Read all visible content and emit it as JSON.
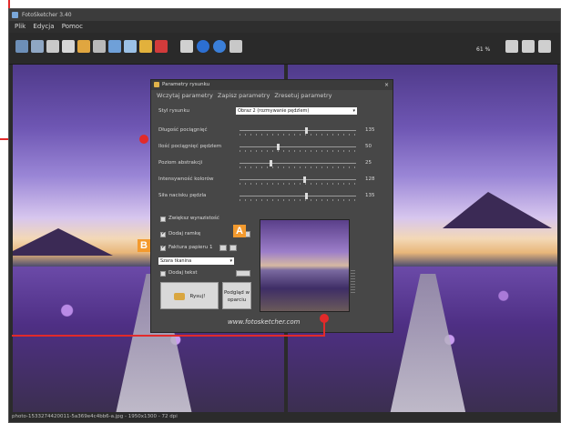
{
  "app": {
    "title": "FotoSketcher 3.40",
    "menu": [
      "Plik",
      "Edycja",
      "Pomoc"
    ],
    "zoom": "61 %",
    "status": "photo-1533274420011-5a369e4c4bb6-a.jpg - 1950x1300 - 72 dpi"
  },
  "dialog": {
    "title": "Parametry rysunku",
    "tabs": [
      "Wczytaj parametry",
      "Zapisz parametry",
      "Zresetuj parametry"
    ],
    "style_label": "Styl rysunku",
    "style_value": "Obraz 2 (rozmywanie pędzlem)",
    "sliders": [
      {
        "label": "Długość pociągnięć",
        "value": "135",
        "level": 0.56
      },
      {
        "label": "Ilość pociągnięć pędzlem",
        "value": "50",
        "level": 0.32
      },
      {
        "label": "Poziom abstrakcji",
        "value": "25",
        "level": 0.26
      },
      {
        "label": "Intensywność kolorów",
        "value": "128",
        "level": 0.55
      },
      {
        "label": "Siła nacisku pędzla",
        "value": "135",
        "level": 0.56
      }
    ],
    "checks": [
      {
        "label": "Zwiększ wyrazistość",
        "checked": false
      },
      {
        "label": "Dodaj ramkę",
        "checked": true
      },
      {
        "label": "Faktura papieru 1",
        "checked": true
      },
      {
        "label": "Dodaj tekst",
        "checked": false
      }
    ],
    "texture_select": "Szara tkanina",
    "draw_button": "Rysuj!",
    "compare_button_line1": "Podgląd w",
    "compare_button_line2": "oparciu",
    "url": "www.fotosketcher.com"
  },
  "callouts": {
    "a": "A",
    "b": "B"
  },
  "colors": {
    "accent": "#f39a2e",
    "marker": "#e22a2a"
  }
}
